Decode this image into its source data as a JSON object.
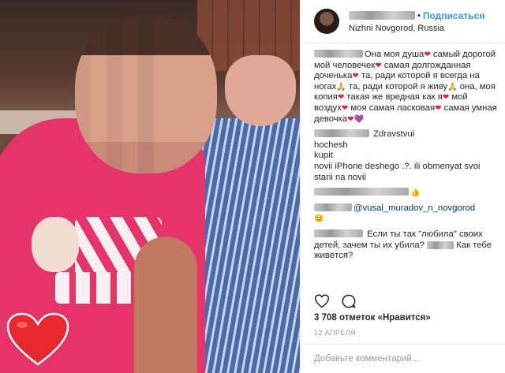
{
  "header": {
    "follow_label": "Подписаться",
    "location": "Nizhni Novgorod, Russia",
    "separator": "•"
  },
  "comments": [
    {
      "parts": [
        {
          "text": "Она моя душа"
        },
        {
          "emoji": "heart"
        },
        {
          "text": " самый дорогой мой человечек"
        },
        {
          "emoji": "heart"
        },
        {
          "text": " самая долгожданная доченька"
        },
        {
          "emoji": "heart"
        },
        {
          "text": " та, ради которой я всегда на ногах"
        },
        {
          "emoji": "pray"
        },
        {
          "text": " та, ради которой я живу"
        },
        {
          "emoji": "pray"
        },
        {
          "text": " она, моя копия"
        },
        {
          "emoji": "heart"
        },
        {
          "text": " такая же вредная как я"
        },
        {
          "emoji": "heart"
        },
        {
          "text": " мой воздух"
        },
        {
          "emoji": "heart"
        },
        {
          "text": " моя самая ласковая"
        },
        {
          "emoji": "heart"
        },
        {
          "text": " самая умная девочка"
        },
        {
          "emoji": "heart"
        },
        {
          "emoji": "purple"
        }
      ]
    },
    {
      "parts": [
        {
          "text": " Zdravstvui"
        },
        {
          "br": true
        },
        {
          "text": "hochesh"
        },
        {
          "br": true
        },
        {
          "text": "kupit"
        },
        {
          "br": true
        },
        {
          "text": "novii iPhone deshego .?. ili obmenyat svoi starii na novii"
        }
      ]
    },
    {
      "parts": [
        {
          "emoji": "thumb"
        }
      ]
    },
    {
      "parts": [
        {
          "mention": "@vusal_muradov_n_novgorod"
        },
        {
          "br": true
        },
        {
          "emoji": "smile"
        }
      ]
    },
    {
      "parts": [
        {
          "text": " Если ты так \"любила\" своих детей, зачем ты их убила? "
        },
        {
          "blur": true
        },
        {
          "text": " Как тебе живётся?"
        }
      ]
    }
  ],
  "comment_user_widths": [
    62,
    70,
    120,
    48,
    62
  ],
  "likes": "3 708 отметок «Нравится»",
  "date": "12 апреля",
  "add_comment_placeholder": "Добавьте комментарий...",
  "colors": {
    "accent": "#3897f0",
    "mention": "#003569",
    "heart": "#ed1c3a"
  }
}
